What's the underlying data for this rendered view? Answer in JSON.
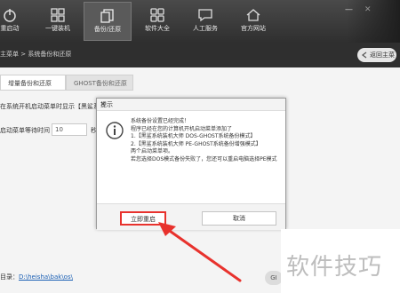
{
  "toolbar": {
    "items": [
      {
        "label": "重启动",
        "icon": "power-icon"
      },
      {
        "label": "一键装机",
        "icon": "windows-icon"
      },
      {
        "label": "备份/还原",
        "icon": "copy-icon"
      },
      {
        "label": "软件大全",
        "icon": "apps-icon"
      },
      {
        "label": "人工服务",
        "icon": "chat-icon"
      },
      {
        "label": "官方网站",
        "icon": "home-icon"
      }
    ],
    "window_controls": [
      "—",
      "✕"
    ]
  },
  "subbar": {
    "breadcrumb": "主菜单  >  系统备份和还原",
    "back_label": "返回主菜"
  },
  "tabs": [
    "增量备份和还原",
    "GHOST备份和还原"
  ],
  "body_text": {
    "line1": "在系统开机启动菜单时显示【黑鲨系统",
    "line2_label": "启动菜单等待时间",
    "line2_value": "10",
    "line2_unit": "秒"
  },
  "dir_row": {
    "label": "目录：",
    "path": "D:\\heisha\\bak\\os\\"
  },
  "right_button": "GI",
  "dialog": {
    "title": "提示",
    "messages": [
      "系统备份设置已经完成！",
      "程序已经在您的计算机开机启动菜单添加了",
      "1.【黑鲨系统装机大师 DOS-GHOST系统备份模式】",
      "2.【黑鲨系统装机大师 PE-GHOST系统备份增强模式】",
      "两个启动菜单项。",
      "若您选择DOS模式备份失败了，您还可以重启电脑选择PE模式"
    ],
    "primary_button": "立即重启",
    "secondary_button": "取消"
  },
  "watermark": "软件技巧",
  "colors": {
    "toolbar_bg": "#3a3a3a",
    "highlight_red": "#e8322d",
    "link_blue": "#1a5fb4"
  }
}
